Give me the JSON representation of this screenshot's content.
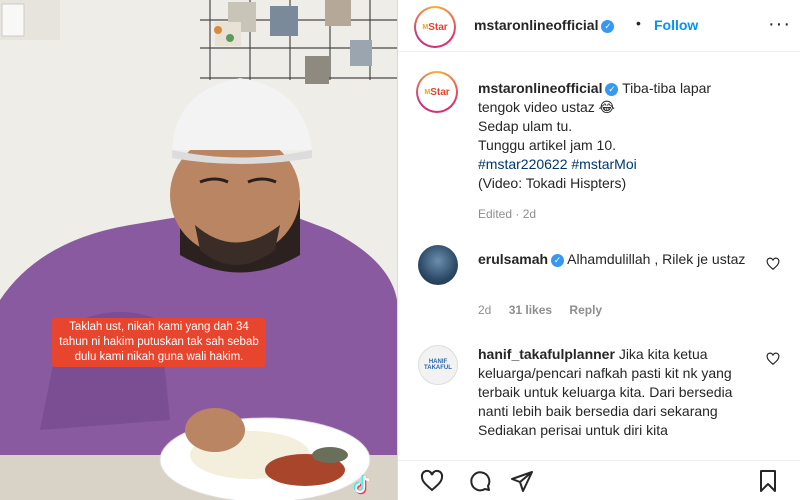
{
  "media": {
    "overlay_caption": "Taklah ust, nikah kami yang dah 34 tahun ni hakim putuskan tak sah sebab dulu kami nikah guna wali hakim."
  },
  "header": {
    "avatar_text_a": "M",
    "avatar_text_b": "Star",
    "username": "mstaronlineofficial",
    "dot": "•",
    "follow_label": "Follow",
    "more_label": "···"
  },
  "post": {
    "username": "mstaronlineofficial",
    "line1": "Tiba-tiba lapar",
    "line2": "tengok video ustaz 😂",
    "line3": "Sedap ulam tu.",
    "line4": "Tunggu artikel jam 10.",
    "hashtags": "#mstar220622 #mstarMoi",
    "line6": "(Video: Tokadi Hispters)",
    "edited": "Edited · 2d"
  },
  "comments": [
    {
      "username": "erulsamah",
      "text": "Alhamdulillah , Rilek je ustaz",
      "time": "2d",
      "likes": "31 likes",
      "reply": "Reply"
    },
    {
      "username": "hanif_takafulplanner",
      "avatar_text": "HANIF TAKAFUL",
      "text": "Jika kita ketua keluarga/pencari nafkah pasti kit nk yang terbaik untuk keluarga kita. Dari bersedia nanti lebih baik bersedia dari sekarang Sediakan perisai untuk diri kita"
    }
  ],
  "colors": {
    "accent": "#0095f6",
    "hashtag": "#00376b",
    "overlay": "#e8452f",
    "shirt": "#8a5aa0"
  }
}
